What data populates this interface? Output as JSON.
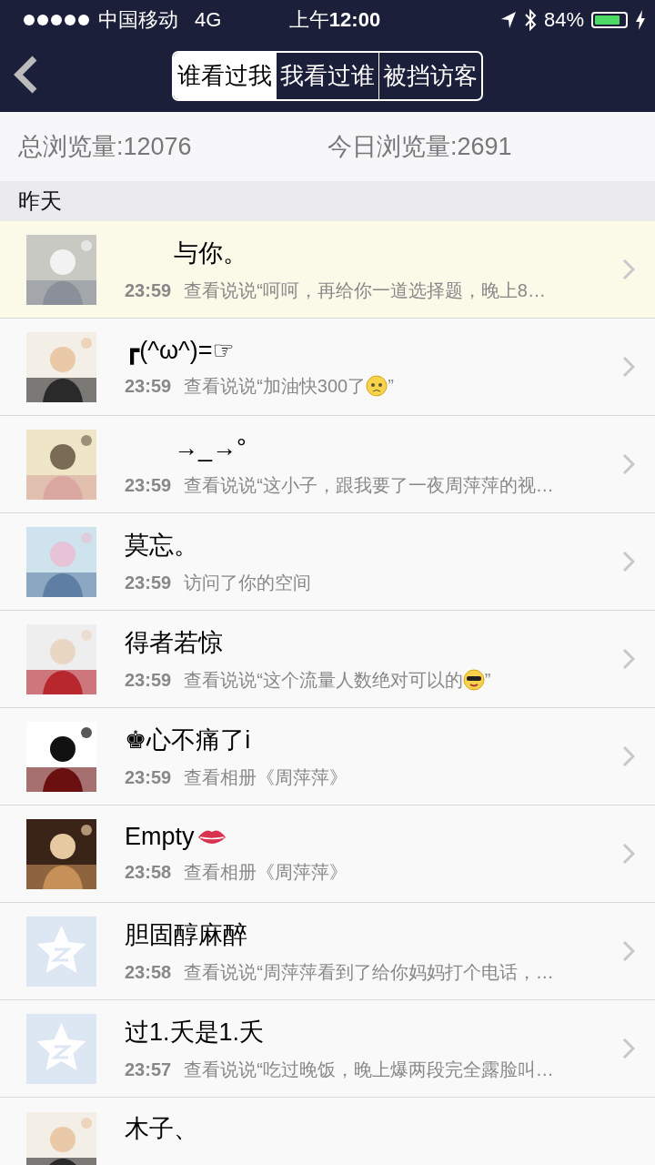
{
  "status_bar": {
    "carrier": "中国移动",
    "network": "4G",
    "time_prefix": "上午",
    "time": "12:00",
    "battery": "84%",
    "charging": true
  },
  "nav": {
    "tabs": [
      {
        "label": "谁看过我",
        "selected": true
      },
      {
        "label": "我看过谁",
        "selected": false
      },
      {
        "label": "被挡访客",
        "selected": false
      }
    ]
  },
  "stats": [
    {
      "text": "总浏览量:12076"
    },
    {
      "text": "今日浏览量:2691"
    }
  ],
  "section": {
    "title": "昨天"
  },
  "visitors": [
    {
      "name": "　　与你。",
      "highlighted": true,
      "avatar": {
        "kind": "picture"
      },
      "time": "23:59",
      "action": [
        {
          "kind": "text",
          "text": "查看说说“呵呵，再给你一道选择题，晚上8…"
        }
      ]
    },
    {
      "name": "┏(^ω^)=☞",
      "highlighted": false,
      "avatar": {
        "kind": "picture"
      },
      "time": "23:59",
      "action": [
        {
          "kind": "text",
          "text": "查看说说“加油快300了"
        },
        {
          "kind": "worried-emoji"
        },
        {
          "kind": "text",
          "text": "”"
        }
      ]
    },
    {
      "name": "　　→_→°",
      "highlighted": false,
      "avatar": {
        "kind": "picture"
      },
      "time": "23:59",
      "action": [
        {
          "kind": "text",
          "text": "查看说说“这小子，跟我要了一夜周萍萍的视…"
        }
      ]
    },
    {
      "name": "莫忘。",
      "highlighted": false,
      "avatar": {
        "kind": "picture"
      },
      "time": "23:59",
      "action": [
        {
          "kind": "text",
          "text": "访问了你的空间"
        }
      ]
    },
    {
      "name": "得者若惊",
      "highlighted": false,
      "avatar": {
        "kind": "picture"
      },
      "time": "23:59",
      "action": [
        {
          "kind": "text",
          "text": "查看说说“这个流量人数绝对可以的"
        },
        {
          "kind": "sunglasses-emoji"
        },
        {
          "kind": "text",
          "text": "”"
        }
      ]
    },
    {
      "name": "♚心不痛了i",
      "highlighted": false,
      "avatar": {
        "kind": "picture"
      },
      "time": "23:59",
      "action": [
        {
          "kind": "text",
          "text": "查看相册《周萍萍》"
        }
      ]
    },
    {
      "name": "Empty",
      "name_icons": [
        {
          "kind": "lips-emoji"
        }
      ],
      "highlighted": false,
      "avatar": {
        "kind": "picture"
      },
      "time": "23:58",
      "action": [
        {
          "kind": "text",
          "text": "查看相册《周萍萍》"
        }
      ]
    },
    {
      "name": "胆固醇麻醉",
      "highlighted": false,
      "avatar": {
        "kind": "default"
      },
      "time": "23:58",
      "action": [
        {
          "kind": "text",
          "text": "查看说说“周萍萍看到了给你妈妈打个电话，…"
        }
      ]
    },
    {
      "name": "过1.夭是1.夭",
      "highlighted": false,
      "avatar": {
        "kind": "default"
      },
      "time": "23:57",
      "action": [
        {
          "kind": "text",
          "text": "查看说说“吃过晚饭，晚上爆两段完全露脸叫…"
        }
      ]
    },
    {
      "name": "木子、",
      "highlighted": false,
      "avatar": {
        "kind": "picture"
      }
    }
  ]
}
